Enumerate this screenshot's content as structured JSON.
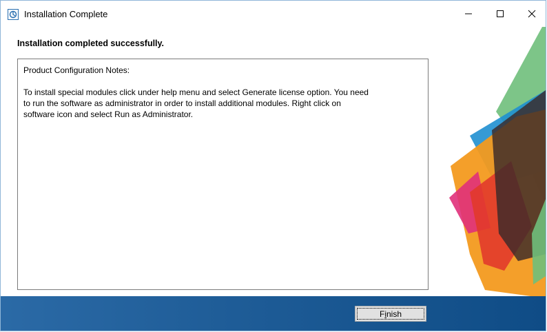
{
  "window": {
    "title": "Installation Complete",
    "minimize_icon": "minimize-icon",
    "maximize_icon": "maximize-icon",
    "close_icon": "close-icon"
  },
  "content": {
    "heading": "Installation completed successfully.",
    "notes_title": "Product Configuration Notes:",
    "notes_body": "To install special modules click under help menu and select Generate license option. You need\nto run the software as administrator in order to install additional modules. Right click on\nsoftware icon and select Run as Administrator."
  },
  "footer": {
    "finish_label_pre": "F",
    "finish_label_ul": "i",
    "finish_label_post": "nish"
  },
  "colors": {
    "footer_bar": "#1f5d98",
    "art_green": "#6fbf7b",
    "art_blue": "#1f8fd0",
    "art_orange": "#f39a1f",
    "art_red": "#e23a2b",
    "art_dark": "#3a2a2a",
    "art_pink": "#e0307a"
  }
}
